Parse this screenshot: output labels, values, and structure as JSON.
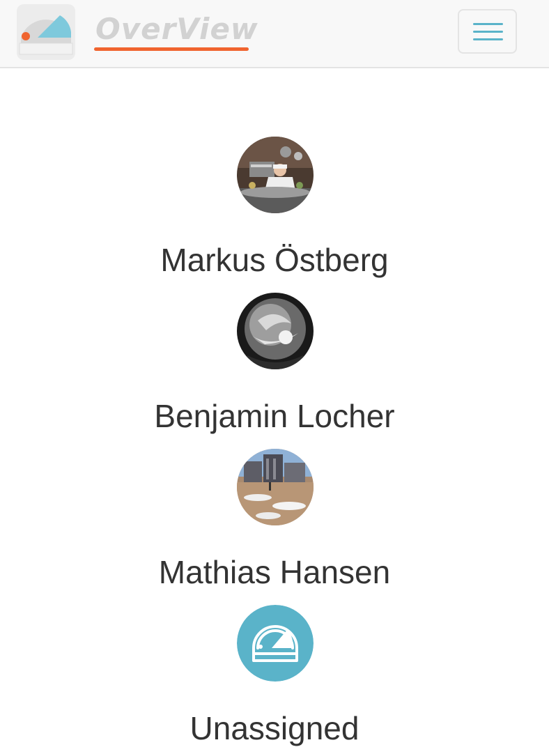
{
  "header": {
    "brand_name": "OverView",
    "logo_icon": "observatory-icon",
    "menu_icon": "hamburger-icon"
  },
  "colors": {
    "brand_accent": "#f0642f",
    "teal": "#5ab3c9",
    "text": "#333333"
  },
  "people": [
    {
      "name": "Markus Östberg",
      "avatar": "photo-chef"
    },
    {
      "name": "Benjamin Locher",
      "avatar": "photo-bw-sphere"
    },
    {
      "name": "Mathias Hansen",
      "avatar": "photo-building-snow"
    },
    {
      "name": "Unassigned",
      "avatar": "observatory-icon"
    }
  ]
}
